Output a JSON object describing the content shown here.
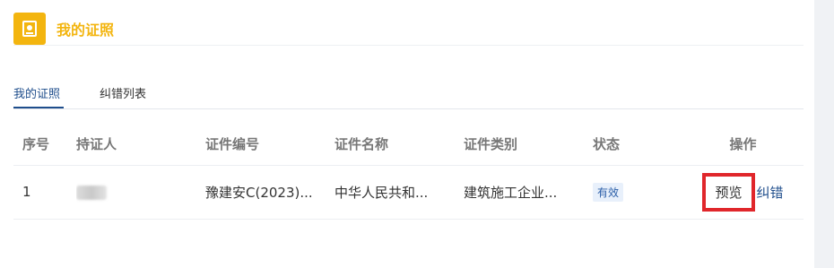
{
  "header": {
    "title": "我的证照",
    "icon": "certificate-icon"
  },
  "tabs": [
    {
      "label": "我的证照",
      "active": true
    },
    {
      "label": "纠错列表",
      "active": false
    }
  ],
  "table": {
    "columns": [
      "序号",
      "持证人",
      "证件编号",
      "证件名称",
      "证件类别",
      "状态",
      "操作"
    ],
    "rows": [
      {
        "index": "1",
        "number": "豫建安C(2023)...",
        "name": "中华人民共和...",
        "category": "建筑施工企业...",
        "status": "有效",
        "actions": {
          "preview": "预览",
          "correct": "纠错"
        }
      }
    ]
  },
  "colors": {
    "accent": "#f3b50f",
    "link": "#1f4e8c",
    "highlight": "#e0262b"
  }
}
